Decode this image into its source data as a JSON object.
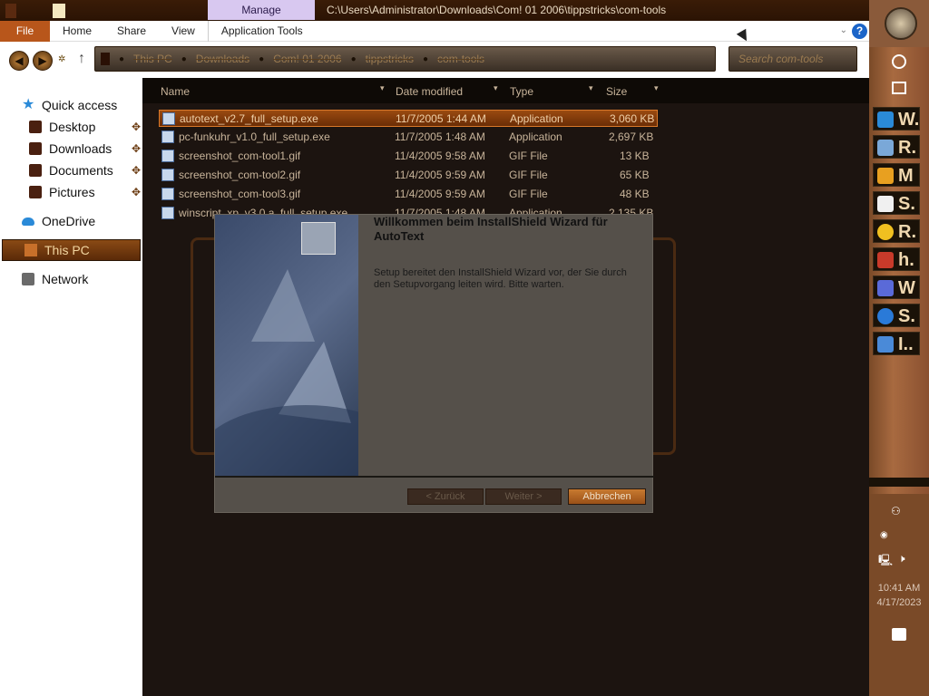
{
  "window": {
    "title_path": "C:\\Users\\Administrator\\Downloads\\Com! 01 2006\\tippstricks\\com-tools",
    "context_tab": "Manage"
  },
  "ribbon": {
    "tabs": [
      "File",
      "Home",
      "Share",
      "View",
      "Application Tools"
    ],
    "help": "?"
  },
  "address": {
    "crumbs": [
      "This PC",
      "Downloads",
      "Com! 01 2006",
      "tippstricks",
      "com-tools"
    ],
    "search_placeholder": "Search com-tools"
  },
  "nav": {
    "quick_access": "Quick access",
    "items": [
      "Desktop",
      "Downloads",
      "Documents",
      "Pictures"
    ],
    "onedrive": "OneDrive",
    "this_pc": "This PC",
    "network": "Network"
  },
  "files": {
    "headers": [
      "Name",
      "Date modified",
      "Type",
      "Size"
    ],
    "rows": [
      {
        "name": "autotext_v2.7_full_setup.exe",
        "date": "11/7/2005 1:44 AM",
        "type": "Application",
        "size": "3,060 KB"
      },
      {
        "name": "pc-funkuhr_v1.0_full_setup.exe",
        "date": "11/7/2005 1:48 AM",
        "type": "Application",
        "size": "2,697 KB"
      },
      {
        "name": "screenshot_com-tool1.gif",
        "date": "11/4/2005 9:58 AM",
        "type": "GIF File",
        "size": "13 KB"
      },
      {
        "name": "screenshot_com-tool2.gif",
        "date": "11/4/2005 9:59 AM",
        "type": "GIF File",
        "size": "65 KB"
      },
      {
        "name": "screenshot_com-tool3.gif",
        "date": "11/4/2005 9:59 AM",
        "type": "GIF File",
        "size": "48 KB"
      },
      {
        "name": "winscript_xp_v3.0.a_full_setup.exe",
        "date": "11/7/2005 1:48 AM",
        "type": "Application",
        "size": "2,135 KB"
      }
    ]
  },
  "dialog": {
    "title": "Willkommen beim InstallShield Wizard für AutoText",
    "text": "Setup bereitet den InstallShield Wizard vor, der Sie durch den Setupvorgang leiten wird. Bitte warten.",
    "buttons": {
      "back": "< Zurück",
      "next": "Weiter >",
      "cancel": "Abbrechen"
    }
  },
  "taskbar": {
    "apps": [
      {
        "letter": "W.",
        "color": "#2a8ad8"
      },
      {
        "letter": "R.",
        "color": "#7aa8d8"
      },
      {
        "letter": "M",
        "color": "#e8a020"
      },
      {
        "letter": "S.",
        "color": "#f0f0f0"
      },
      {
        "letter": "R.",
        "color": "#f0c020"
      },
      {
        "letter": "h.",
        "color": "#c83a2a"
      },
      {
        "letter": "W",
        "color": "#5a6ad8"
      },
      {
        "letter": "S.",
        "color": "#2a7ad8"
      },
      {
        "letter": "I..",
        "color": "#4a8ad8"
      }
    ],
    "time": "10:41 AM",
    "date": "4/17/2023"
  }
}
